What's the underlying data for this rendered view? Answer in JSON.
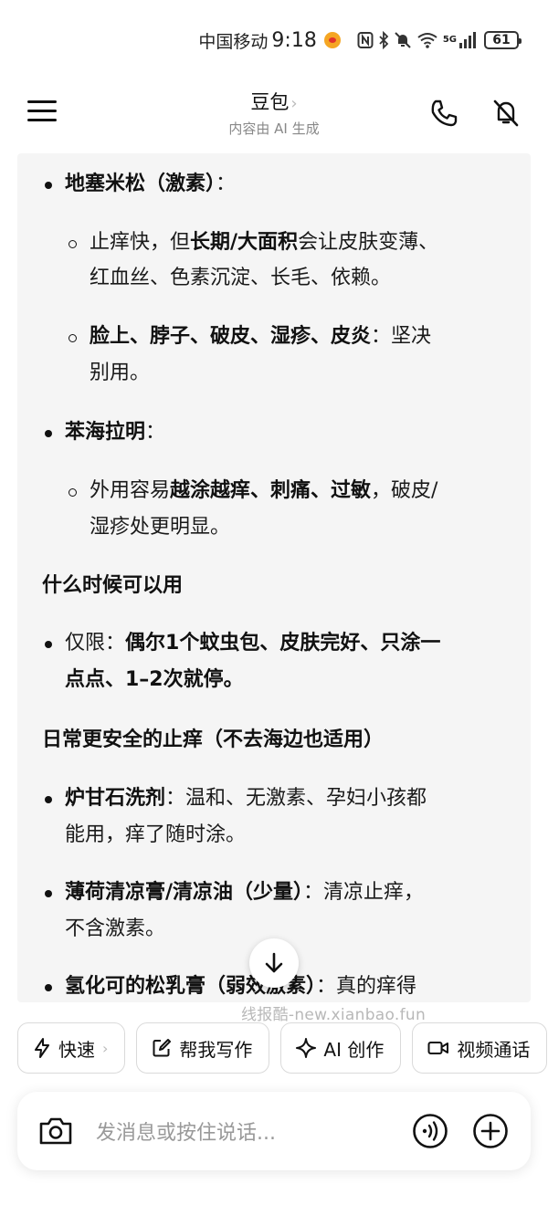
{
  "status": {
    "carrier": "中国移动",
    "time": "9:18",
    "network": "5G",
    "battery": "61"
  },
  "header": {
    "title": "豆包",
    "title_chevron": "›",
    "subtitle": "内容由 AI 生成"
  },
  "content": {
    "item1_title": "地塞米松（激素）",
    "item1_colon": "：",
    "item1_sub1_a": "止痒快，但",
    "item1_sub1_b": "长期/大面积",
    "item1_sub1_c": "会让皮肤变薄、",
    "item1_sub1_line2": "红血丝、色素沉淀、长毛、依赖。",
    "item1_sub2_a": "脸上、脖子、破皮、湿疹、皮炎",
    "item1_sub2_b": "：坚决",
    "item1_sub2_line2": "别用。",
    "item2_title": "苯海拉明",
    "item2_colon": "：",
    "item2_sub1_a": "外用容易",
    "item2_sub1_b": "越涂越痒、刺痛、过敏",
    "item2_sub1_c": "，破皮/",
    "item2_sub1_line2": "湿疹处更明显。",
    "heading1": "什么时候可以用",
    "item3_a": "仅限：",
    "item3_b": "偶尔1个蚊虫包、皮肤完好、只涂一",
    "item3_line2": "点点、1–2次就停。",
    "heading2": "日常更安全的止痒（不去海边也适用）",
    "item4_title": "炉甘石洗剂",
    "item4_rest": "：温和、无激素、孕妇小孩都",
    "item4_line2": "能用，痒了随时涂。",
    "item5_title": "薄荷清凉膏/清凉油（少量）",
    "item5_rest": "：清凉止痒，",
    "item5_line2": "不含激素。",
    "item6_title": "氢化可的松乳膏（弱效激素）",
    "item6_rest": "：真的痒得"
  },
  "watermark": "线报酷-new.xianbao.fun",
  "chips": [
    {
      "label": "快速",
      "icon": "lightning-icon"
    },
    {
      "label": "帮我写作",
      "icon": "edit-icon"
    },
    {
      "label": "AI 创作",
      "icon": "sparkle-icon"
    },
    {
      "label": "视频通话",
      "icon": "video-icon"
    }
  ],
  "input": {
    "placeholder": "发消息或按住说话..."
  }
}
